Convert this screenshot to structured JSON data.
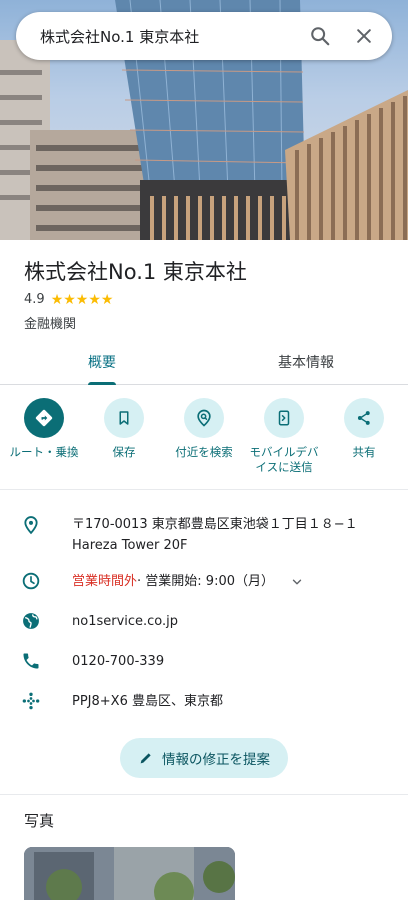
{
  "search": {
    "query": "株式会社No.1 東京本社"
  },
  "place": {
    "name": "株式会社No.1 東京本社",
    "rating": "4.9",
    "stars": "★★★★★",
    "category": "金融機関"
  },
  "tabs": [
    {
      "label": "概要"
    },
    {
      "label": "基本情報"
    }
  ],
  "actions": [
    {
      "label": "ルート・乗換"
    },
    {
      "label": "保存"
    },
    {
      "label": "付近を検索"
    },
    {
      "label": "モバイルデバイスに送信"
    },
    {
      "label": "共有"
    }
  ],
  "details": {
    "address_line1": "〒170-0013 東京都豊島区東池袋１丁目１８−１",
    "address_line2": "Hareza Tower 20F",
    "hours_status": "営業時間外",
    "hours_next": " · 営業開始: 9:00（月）",
    "website": "no1service.co.jp",
    "phone": "0120-700-339",
    "plus_code": "PPJ8+X6 豊島区、東京都"
  },
  "suggest_edit_label": "情報の修正を提案",
  "photos_title": "写真",
  "colors": {
    "accent": "#0b6e76",
    "accent_light": "#d6f0f3",
    "closed": "#d93025",
    "star": "#fbbc04"
  }
}
